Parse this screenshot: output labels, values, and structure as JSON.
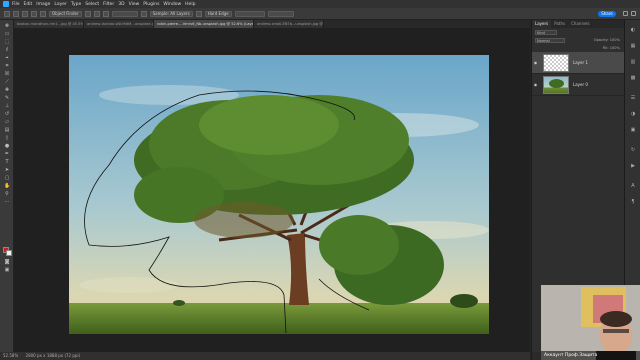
{
  "menubar": {
    "items": [
      "File",
      "Edit",
      "Image",
      "Layer",
      "Type",
      "Select",
      "Filter",
      "3D",
      "View",
      "Plugins",
      "Window",
      "Help"
    ]
  },
  "options": {
    "object_finder": "Object Finder",
    "sample_label": "Sample: All Layers",
    "hard_edge": "Hard Edge",
    "share_label": "Share"
  },
  "tabs": [
    {
      "label": "boston-marathon-rlm1...jpg @ 45.5% (RGB/8)",
      "active": false
    },
    {
      "label": "andrew-dunbar-sNUrNtM...unsplash.jpg @ 44%",
      "active": false
    },
    {
      "label": "robin-pierre-...Vmrv6_Nb-unsplash.jpg @ 52.6% (Layer 1, RGB/8)",
      "active": true
    },
    {
      "label": "andrew-small-EN7b...unsplash.jpg @ 41.1%",
      "active": false
    }
  ],
  "status": {
    "zoom": "52.58%",
    "doc_info": "2800 px x 1888 px (72 ppi)"
  },
  "layers_panel": {
    "tabs": [
      "Layers",
      "Paths",
      "Channels"
    ],
    "filter_label": "Kind",
    "blend_mode": "Normal",
    "opacity_label": "Opacity: 100%",
    "fill_label": "Fill: 100%",
    "layers": [
      {
        "name": "Layer 1",
        "selected": true,
        "thumb": "transparent"
      },
      {
        "name": "Layer 0",
        "selected": false,
        "thumb": "tree-photo"
      }
    ]
  },
  "webcam": {
    "caption": "Аккаунт Проф.Защита"
  },
  "colors": {
    "foreground": "#d11a1a",
    "background": "#f2f2f2",
    "accent": "#1473e6"
  },
  "icons": {
    "app_logo": "photoshop-logo-icon",
    "eye": "eye-icon"
  }
}
